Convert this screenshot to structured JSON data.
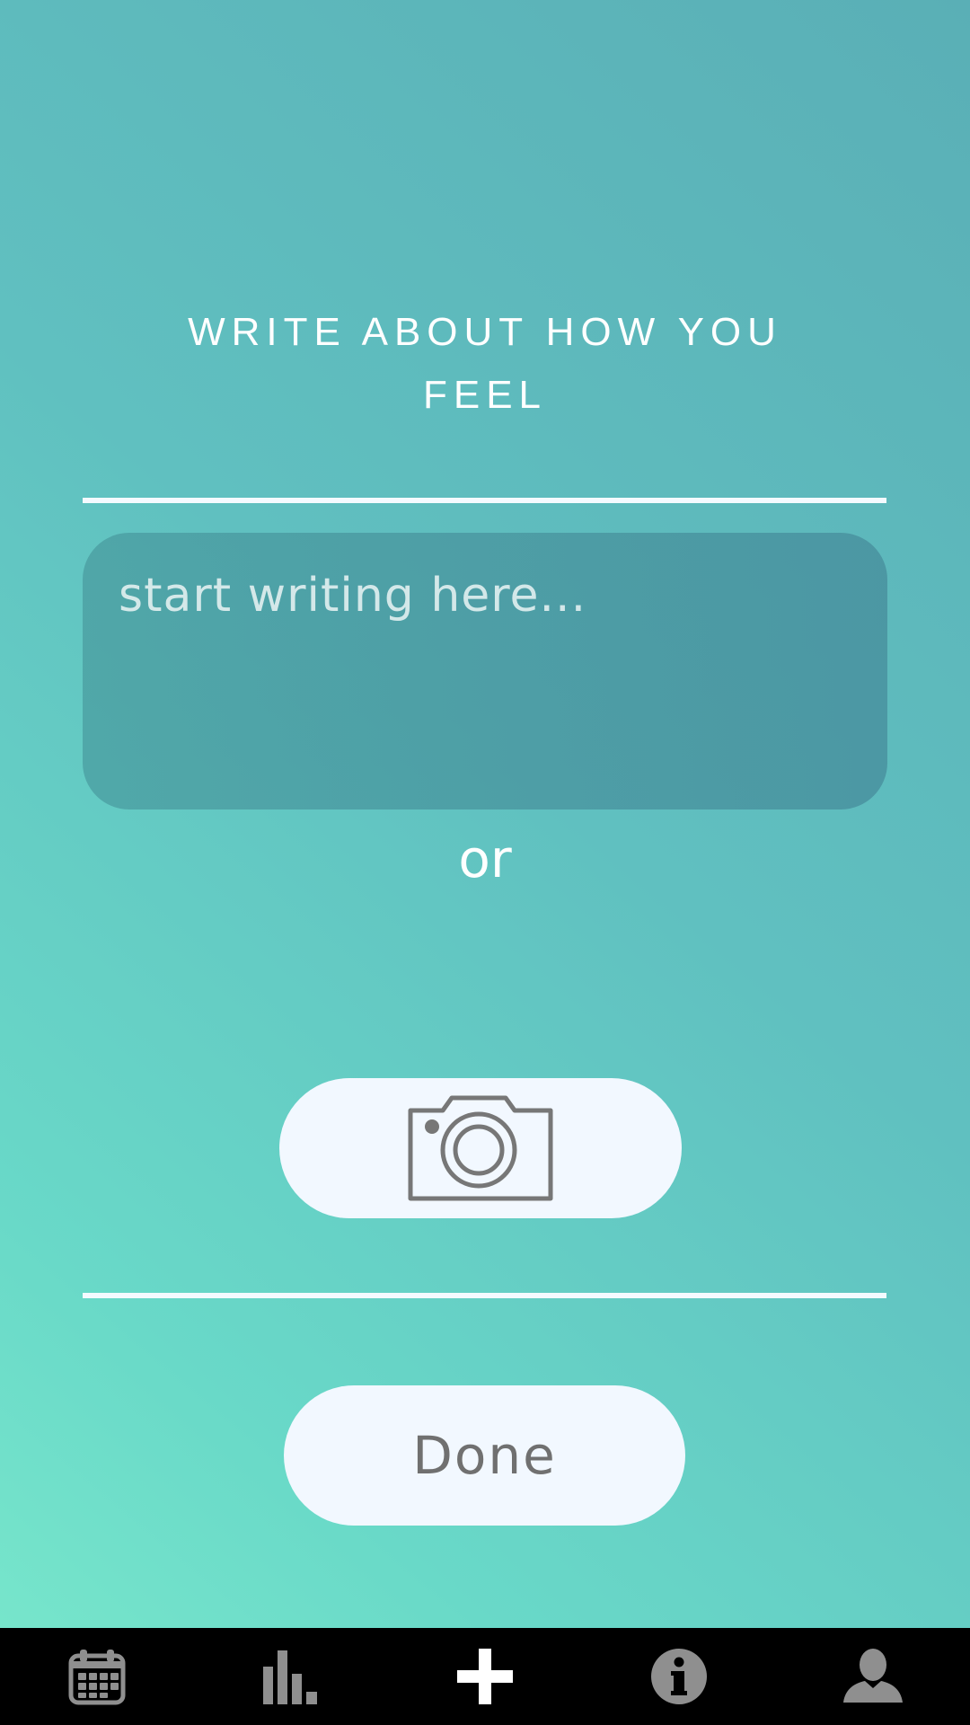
{
  "journal": {
    "heading": "WRITE ABOUT HOW YOU FEEL",
    "placeholder": "start writing here...",
    "value": ""
  },
  "separator_text": "or",
  "photo_button": {
    "icon": "camera-icon"
  },
  "done_button": {
    "label": "Done"
  },
  "bottom_nav": {
    "items": [
      {
        "icon": "calendar-icon",
        "active": false
      },
      {
        "icon": "bar-chart-icon",
        "active": false
      },
      {
        "icon": "plus-icon",
        "active": true
      },
      {
        "icon": "info-icon",
        "active": false
      },
      {
        "icon": "user-icon",
        "active": false
      }
    ]
  },
  "colors": {
    "gradient_light": "#7ae8cc",
    "gradient_dark": "#5aafb6",
    "button_bg": "#f2f8ff",
    "nav_bg": "#000000",
    "nav_icon_inactive": "#8f8f8f",
    "nav_icon_active": "#ffffff"
  }
}
